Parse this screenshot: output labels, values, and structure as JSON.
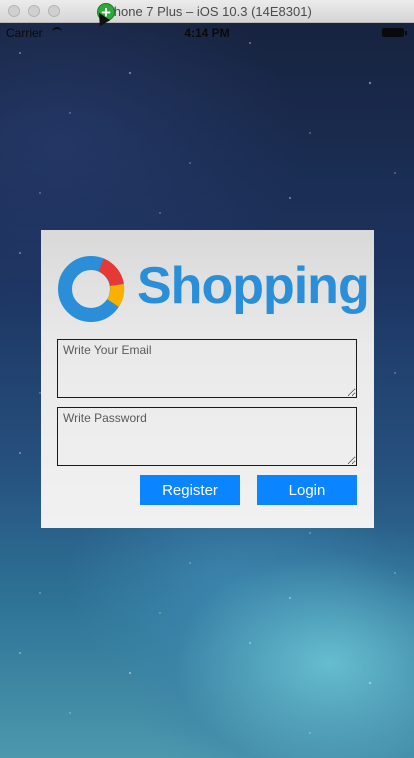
{
  "window": {
    "title": "iPhone 7 Plus – iOS 10.3 (14E8301)"
  },
  "status_bar": {
    "carrier": "Carrier",
    "time": "4:14 PM",
    "add_icon": "+"
  },
  "login": {
    "brand": "Shopping",
    "email_placeholder": "Write Your Email",
    "password_placeholder": "Write Password",
    "register_label": "Register",
    "login_label": "Login"
  },
  "colors": {
    "brand_blue": "#2a8fd8",
    "button_blue": "#0a84ff",
    "logo_red": "#e53935",
    "logo_yellow": "#f9b000"
  },
  "icons": [
    "wifi-icon",
    "battery-icon",
    "add-icon",
    "shopping-logo-icon"
  ]
}
